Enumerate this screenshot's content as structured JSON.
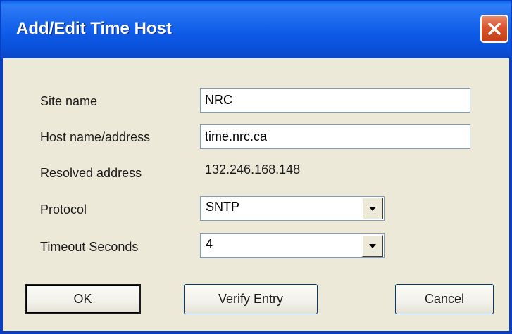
{
  "window": {
    "title": "Add/Edit Time Host"
  },
  "form": {
    "site_name": {
      "label": "Site name",
      "value": "NRC"
    },
    "host_name": {
      "label": "Host name/address",
      "value": "time.nrc.ca"
    },
    "resolved": {
      "label": "Resolved address",
      "value": "132.246.168.148"
    },
    "protocol": {
      "label": "Protocol",
      "value": "SNTP"
    },
    "timeout": {
      "label": "Timeout Seconds",
      "value": "4"
    }
  },
  "buttons": {
    "ok_label": "OK",
    "verify_label": "Verify Entry",
    "cancel_label": "Cancel"
  },
  "icons": {
    "close": "close-icon",
    "dropdown": "chevron-down-icon"
  },
  "colors": {
    "titlebar": "#0a57e4",
    "close_button": "#d8532b",
    "dialog_background": "#ece9d8"
  }
}
